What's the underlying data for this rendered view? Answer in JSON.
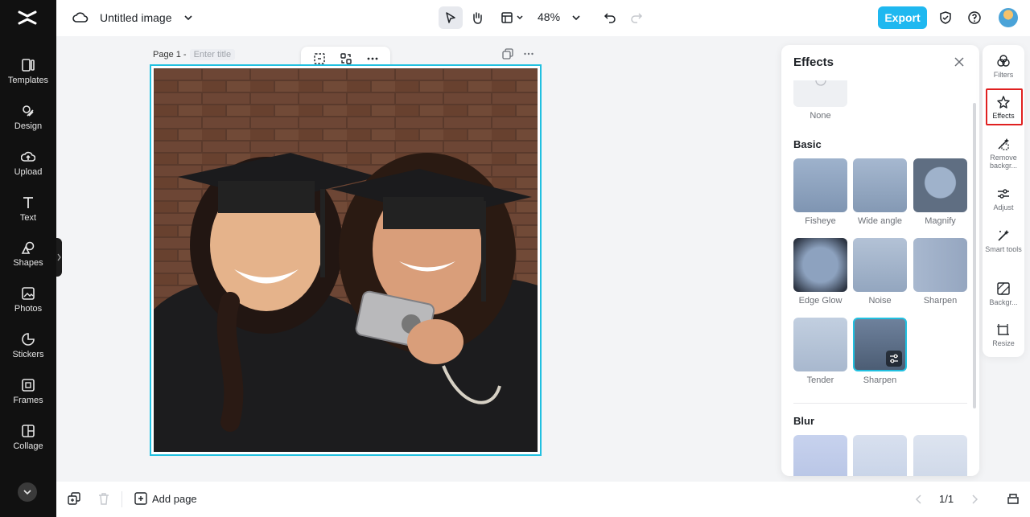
{
  "app": {
    "logo_icon": "capcut-logo-icon"
  },
  "left_nav": [
    {
      "label": "Templates",
      "icon": "templates-icon"
    },
    {
      "label": "Design",
      "icon": "design-icon"
    },
    {
      "label": "Upload",
      "icon": "upload-icon"
    },
    {
      "label": "Text",
      "icon": "text-icon"
    },
    {
      "label": "Shapes",
      "icon": "shapes-icon"
    },
    {
      "label": "Photos",
      "icon": "photos-icon"
    },
    {
      "label": "Stickers",
      "icon": "stickers-icon"
    },
    {
      "label": "Frames",
      "icon": "frames-icon"
    },
    {
      "label": "Collage",
      "icon": "collage-icon"
    }
  ],
  "header": {
    "title": "Untitled image",
    "zoom": "48%",
    "export_label": "Export"
  },
  "canvas": {
    "page_label": "Page 1 -",
    "title_placeholder": "Enter title"
  },
  "effects_panel": {
    "title": "Effects",
    "none_label": "None",
    "basic_heading": "Basic",
    "basic_items": [
      "Fisheye",
      "Wide angle",
      "Magnify",
      "Edge Glow",
      "Noise",
      "Sharpen",
      "Tender",
      "Sharpen"
    ],
    "blur_heading": "Blur"
  },
  "right_rail": [
    {
      "label": "Filters",
      "icon": "filters-icon"
    },
    {
      "label": "Effects",
      "icon": "effects-icon"
    },
    {
      "label": "Remove backgr...",
      "icon": "remove-background-icon"
    },
    {
      "label": "Adjust",
      "icon": "adjust-icon"
    },
    {
      "label": "Smart tools",
      "icon": "smart-tools-icon"
    },
    {
      "label": "Backgr...",
      "icon": "background-icon"
    },
    {
      "label": "Resize",
      "icon": "resize-icon"
    }
  ],
  "bottom": {
    "add_page_label": "Add page",
    "page_counter": "1/1"
  },
  "colors": {
    "accent": "#1fb8f0",
    "selection": "#21c0e0",
    "highlight": "#e02020"
  }
}
